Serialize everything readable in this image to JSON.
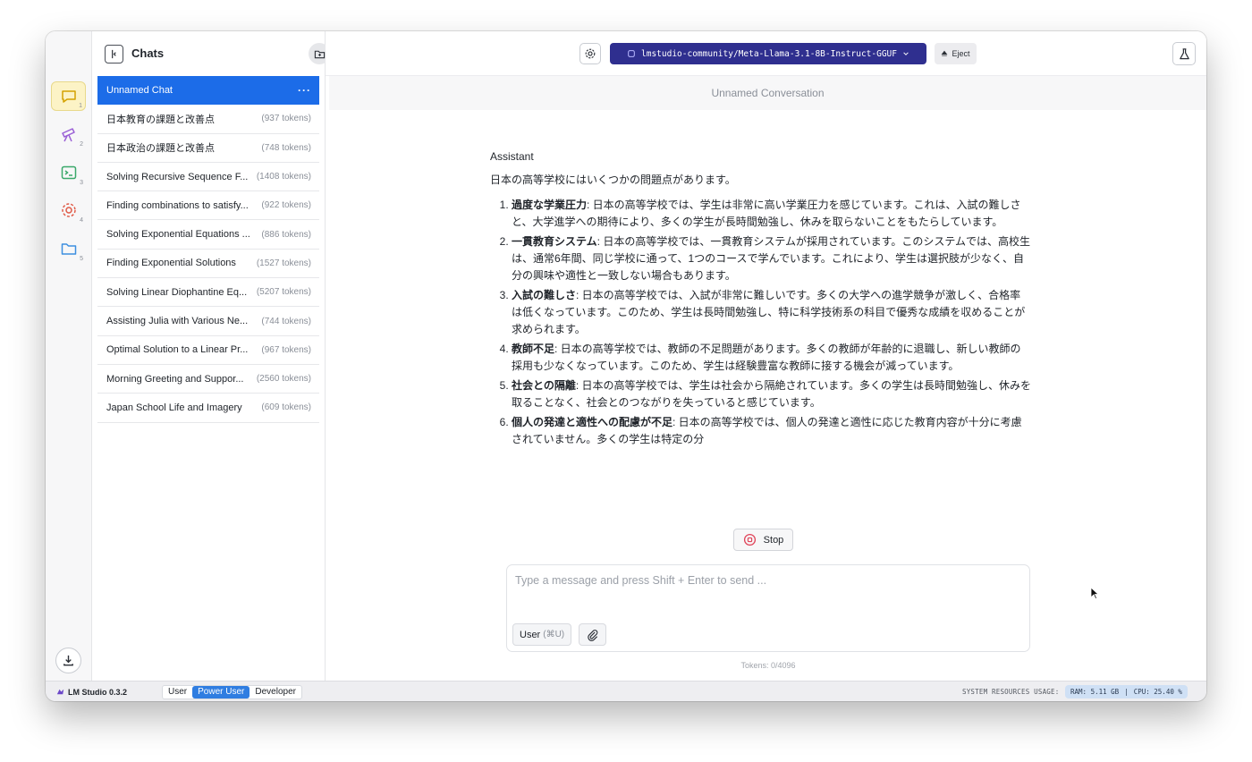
{
  "sidebar": {
    "title": "Chats",
    "chats": [
      {
        "title": "Unnamed Chat",
        "tokens": "",
        "active": true
      },
      {
        "title": "日本教育の課題と改善点",
        "tokens": "(937 tokens)"
      },
      {
        "title": "日本政治の課題と改善点",
        "tokens": "(748 tokens)"
      },
      {
        "title": "Solving Recursive Sequence F...",
        "tokens": "(1408 tokens)"
      },
      {
        "title": "Finding combinations to satisfy...",
        "tokens": "(922 tokens)"
      },
      {
        "title": "Solving Exponential Equations ...",
        "tokens": "(886 tokens)"
      },
      {
        "title": "Finding Exponential Solutions",
        "tokens": "(1527 tokens)"
      },
      {
        "title": "Solving Linear Diophantine Eq...",
        "tokens": "(5207 tokens)"
      },
      {
        "title": "Assisting Julia with Various Ne...",
        "tokens": "(744 tokens)"
      },
      {
        "title": "Optimal Solution to a Linear Pr...",
        "tokens": "(967 tokens)"
      },
      {
        "title": "Morning Greeting and Suppor...",
        "tokens": "(2560 tokens)"
      },
      {
        "title": "Japan School Life and Imagery",
        "tokens": "(609 tokens)"
      }
    ],
    "active_menu": "···"
  },
  "rail": {
    "numbers": [
      "1",
      "2",
      "3",
      "4",
      "5"
    ]
  },
  "topbar": {
    "model": "lmstudio-community/Meta-Llama-3.1-8B-Instruct-GGUF",
    "eject_label": "Eject"
  },
  "conversation": {
    "title": "Unnamed Conversation",
    "role": "Assistant",
    "intro": "日本の高等学校にはいくつかの問題点があります。",
    "items": [
      {
        "term": "過度な学業圧力",
        "text": ": 日本の高等学校では、学生は非常に高い学業圧力を感じています。これは、入試の難しさと、大学進学への期待により、多くの学生が長時間勉強し、休みを取らないことをもたらしています。"
      },
      {
        "term": "一貫教育システム",
        "text": ": 日本の高等学校では、一貫教育システムが採用されています。このシステムでは、高校生は、通常6年間、同じ学校に通って、1つのコースで学んでいます。これにより、学生は選択肢が少なく、自分の興味や適性と一致しない場合もあります。"
      },
      {
        "term": "入試の難しさ",
        "text": ": 日本の高等学校では、入試が非常に難しいです。多くの大学への進学競争が激しく、合格率は低くなっています。このため、学生は長時間勉強し、特に科学技術系の科目で優秀な成績を収めることが求められます。"
      },
      {
        "term": "教師不足",
        "text": ": 日本の高等学校では、教師の不足問題があります。多くの教師が年齢的に退職し、新しい教師の採用も少なくなっています。このため、学生は経験豊富な教師に接する機会が減っています。"
      },
      {
        "term": "社会との隔離",
        "text": ": 日本の高等学校では、学生は社会から隔絶されています。多くの学生は長時間勉強し、休みを取ることなく、社会とのつながりを失っていると感じています。"
      },
      {
        "term": "個人の発達と適性への配慮が不足",
        "text": ": 日本の高等学校では、個人の発達と適性に応じた教育内容が十分に考慮されていません。多くの学生は特定の分"
      }
    ]
  },
  "composer": {
    "stop_label": "Stop",
    "placeholder": "Type a message and press Shift + Enter to send ...",
    "value": "",
    "role_label": "User",
    "role_shortcut": "(⌘U)",
    "token_count": "Tokens: 0/4096"
  },
  "statusbar": {
    "app_name": "LM Studio 0.3.2",
    "modes": [
      "User",
      "Power User",
      "Developer"
    ],
    "active_mode": "Power User",
    "resources_label": "SYSTEM RESOURCES USAGE:",
    "ram": "RAM: 5.11 GB",
    "separator": "|",
    "cpu": "CPU: 25.40 %"
  },
  "colors": {
    "accent": "#1c6ce8",
    "model_bar": "#2f2f8f",
    "chat_active_rail": "#fcf3c6"
  }
}
